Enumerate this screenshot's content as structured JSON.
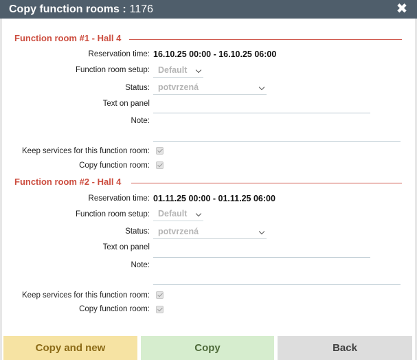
{
  "dialog": {
    "title_prefix": "Copy function rooms :",
    "title_number": "1176",
    "close_glyph": "✖"
  },
  "labels": {
    "reservation_time": "Reservation time:",
    "setup": "Function room setup:",
    "status": "Status:",
    "text_on_panel": "Text on panel",
    "note": "Note:",
    "keep_services": "Keep services for this function room:",
    "copy_room": "Copy function room:"
  },
  "rooms": [
    {
      "heading": "Function room #1 - Hall 4",
      "reservation_time": "16.10.25 00:00 - 16.10.25 06:00",
      "setup": "Default",
      "status": "potvrzená",
      "text_on_panel": "",
      "note": "",
      "keep_services_checked": true,
      "copy_checked": true
    },
    {
      "heading": "Function room #2 - Hall 4",
      "reservation_time": "01.11.25 00:00 - 01.11.25 06:00",
      "setup": "Default",
      "status": "potvrzená",
      "text_on_panel": "",
      "note": "",
      "keep_services_checked": true,
      "copy_checked": true
    }
  ],
  "buttons": {
    "copy_and_new": "Copy and new",
    "copy": "Copy",
    "back": "Back"
  },
  "colors": {
    "titlebar": "#4f5e6b",
    "section_heading": "#cc4d3f",
    "btn_copy_and_new": "#f6e3a3",
    "btn_copy": "#d6edce",
    "btn_back": "#dddddd"
  }
}
